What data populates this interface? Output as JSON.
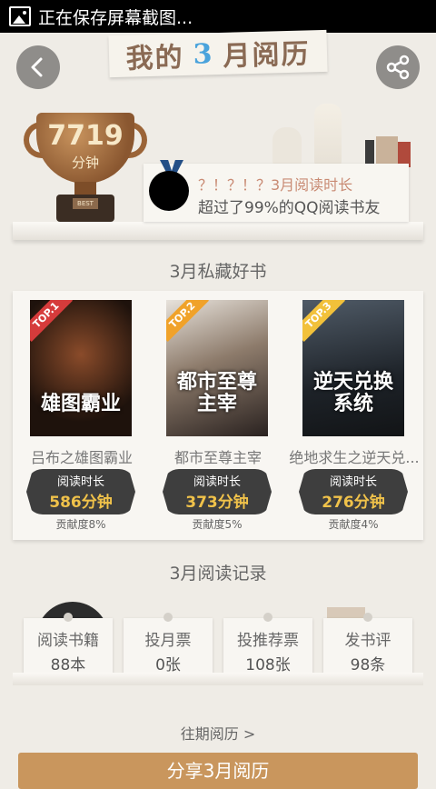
{
  "statusbar": {
    "text": "正在保存屏幕截图..."
  },
  "header": {
    "title_prefix": "我的",
    "title_month": "3",
    "title_suffix": "月阅历"
  },
  "trophy": {
    "minutes": "7719",
    "unit": "分钟",
    "best_label": "BEST"
  },
  "rank": {
    "line1": "？！？！？3月阅读时长",
    "line2": "超过了99%的QQ阅读书友"
  },
  "sections": {
    "books_title": "3月私藏好书",
    "records_title": "3月阅读记录"
  },
  "books": [
    {
      "tag": "TOP.1",
      "cover_text": "雄图霸业",
      "title": "吕布之雄图霸业",
      "badge_label": "阅读时长",
      "badge_value": "586分钟",
      "contrib": "贡献度8%"
    },
    {
      "tag": "TOP.2",
      "cover_text": "都市至尊主宰",
      "title": "都市至尊主宰",
      "badge_label": "阅读时长",
      "badge_value": "373分钟",
      "contrib": "贡献度5%"
    },
    {
      "tag": "TOP.3",
      "cover_text": "逆天兑换系统",
      "title": "绝地求生之逆天兑...",
      "badge_label": "阅读时长",
      "badge_value": "276分钟",
      "contrib": "贡献度4%"
    }
  ],
  "records": [
    {
      "label": "阅读书籍",
      "value": "88本"
    },
    {
      "label": "投月票",
      "value": "0张"
    },
    {
      "label": "投推荐票",
      "value": "108张"
    },
    {
      "label": "发书评",
      "value": "98条"
    }
  ],
  "footer": {
    "past_link": "往期阅历 >",
    "share_button": "分享3月阅历"
  },
  "colors": {
    "accent": "#c9965d",
    "badge_gold": "#f0c24a",
    "top1": "#d63b3b",
    "top2": "#f0a22a",
    "top3": "#f2c13a"
  }
}
